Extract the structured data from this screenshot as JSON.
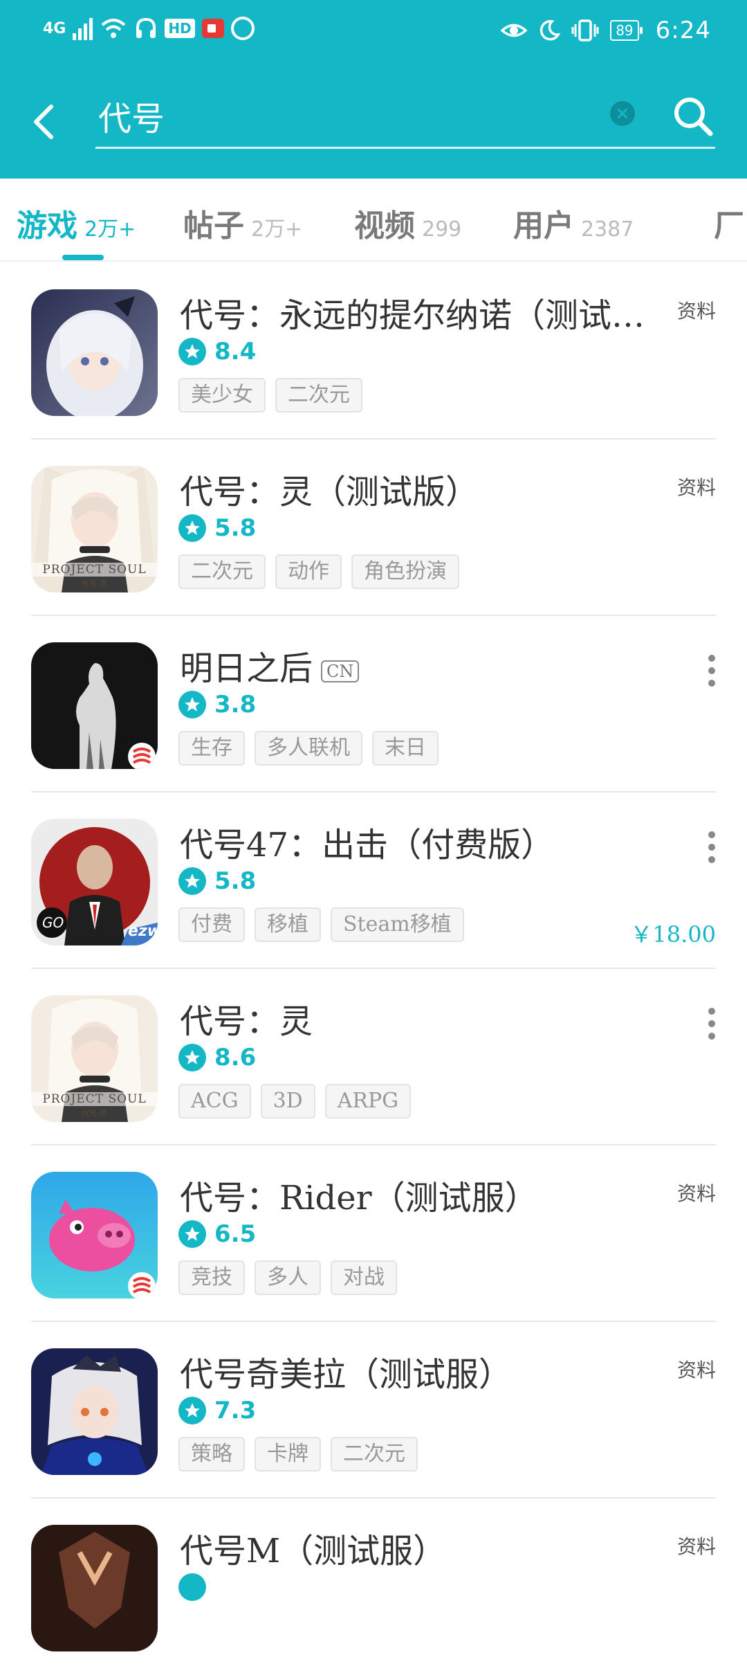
{
  "status_bar": {
    "network": "4G",
    "hd_badge": "HD",
    "battery": "89",
    "time": "6:24"
  },
  "search": {
    "query": "代号",
    "placeholder": ""
  },
  "tabs": [
    {
      "label": "游戏",
      "count": "2万+",
      "active": true
    },
    {
      "label": "帖子",
      "count": "2万+",
      "active": false
    },
    {
      "label": "视频",
      "count": "299",
      "active": false
    },
    {
      "label": "用户",
      "count": "2387",
      "active": false
    },
    {
      "label": "厂",
      "count": "",
      "active": false
    }
  ],
  "colors": {
    "accent": "#13b7c6",
    "separator": "#e7e7e7",
    "tag_bg": "#f5f5f5"
  },
  "results": [
    {
      "name": "代号：永远的提尔纳诺（测试…",
      "rating": "8.4",
      "tags": [
        "美少女",
        "二次元"
      ],
      "side": "资料",
      "has_more": false,
      "price": "",
      "cn": "",
      "icon": "silver-hair-girl-icon"
    },
    {
      "name": "代号：灵（测试版）",
      "rating": "5.8",
      "tags": [
        "二次元",
        "动作",
        "角色扮演"
      ],
      "side": "资料",
      "has_more": false,
      "price": "",
      "cn": "",
      "icon": "project-soul-icon"
    },
    {
      "name": "明日之后",
      "rating": "3.8",
      "tags": [
        "生存",
        "多人联机",
        "末日"
      ],
      "side": "",
      "has_more": true,
      "price": "",
      "cn": "CN",
      "icon": "silhouette-forest-icon"
    },
    {
      "name": "代号47：出击（付费版）",
      "rating": "5.8",
      "tags": [
        "付费",
        "移植",
        "Steam移植"
      ],
      "side": "",
      "has_more": true,
      "price": "￥18.00",
      "cn": "",
      "icon": "hitman-icon"
    },
    {
      "name": "代号：灵",
      "rating": "8.6",
      "tags": [
        "ACG",
        "3D",
        "ARPG"
      ],
      "side": "",
      "has_more": true,
      "price": "",
      "cn": "",
      "icon": "project-soul-icon"
    },
    {
      "name": "代号：Rider（测试服）",
      "rating": "6.5",
      "tags": [
        "竞技",
        "多人",
        "对战"
      ],
      "side": "资料",
      "has_more": false,
      "price": "",
      "cn": "",
      "icon": "pink-pig-icon"
    },
    {
      "name": "代号奇美拉（测试服）",
      "rating": "7.3",
      "tags": [
        "策略",
        "卡牌",
        "二次元"
      ],
      "side": "资料",
      "has_more": false,
      "price": "",
      "cn": "",
      "icon": "chimera-girl-icon"
    },
    {
      "name": "代号M（测试服）",
      "rating": "",
      "tags": [],
      "side": "资料",
      "has_more": false,
      "price": "",
      "cn": "",
      "icon": "bronze-mask-icon"
    }
  ],
  "icon_texts": {
    "project_soul": "PROJECT SOUL",
    "project_soul_sub": "代号:灵",
    "go_badge": "GO",
    "ezw_badge": "ezw"
  }
}
